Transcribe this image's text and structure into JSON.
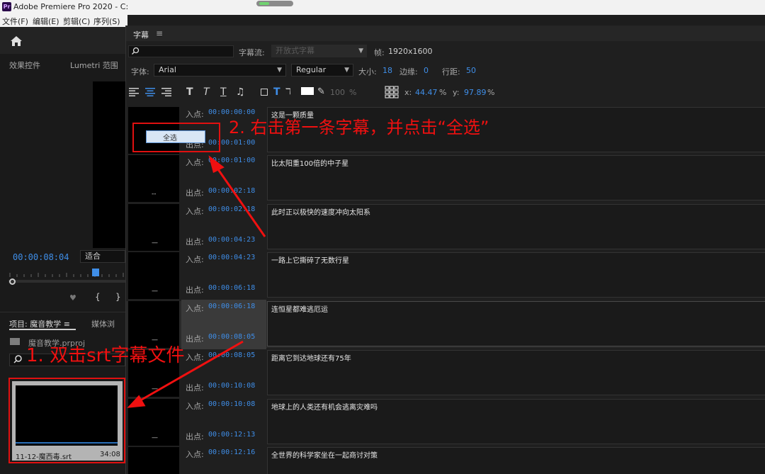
{
  "titlebar": {
    "app_icon": "Pr",
    "title": "Adobe Premiere Pro 2020 - C:"
  },
  "menubar": {
    "items": [
      "文件(F)",
      "编辑(E)",
      "剪辑(C)",
      "序列(S)"
    ]
  },
  "left_panel": {
    "tabs": {
      "effect_controls": "效果控件",
      "lumetri": "Lumetri 范围"
    },
    "timecode": "00:00:08:04",
    "fit": "适合",
    "project": {
      "tab": "项目: 魔音教学 ≡",
      "media_tab": "媒体浏",
      "file": "魔音教学.prproj",
      "thumbnail_name": "11-12-魔西毒.srt",
      "thumbnail_duration": "34:08"
    }
  },
  "caption_panel": {
    "title": "字幕",
    "stream_label": "字幕流:",
    "stream_value": "开放式字幕",
    "frame_label": "帧:",
    "frame_value": "1920x1600",
    "font_label": "字体:",
    "font_value": "Arial",
    "style_value": "Regular",
    "size_label": "大小:",
    "size_value": "18",
    "margin_label": "边缘:",
    "margin_value": "0",
    "lead_label": "行距:",
    "lead_value": "50",
    "opacity_value": "100",
    "opacity_pct": "%",
    "x_label": "x:",
    "x_value": "44.47",
    "y_label": "y:",
    "y_value": "97.89",
    "pct": "%",
    "in_label": "入点:",
    "out_label": "出点:",
    "rows": [
      {
        "in": "00:00:00:00",
        "out": "00:00:01:00",
        "text": "这是一颗质量",
        "mark": ""
      },
      {
        "in": "00:00:01:00",
        "out": "00:00:02:18",
        "text": "比太阳重100倍的中子星",
        "mark": "--"
      },
      {
        "in": "00:00:02:18",
        "out": "00:00:04:23",
        "text": "此时正以极快的速度冲向太阳系",
        "mark": "—"
      },
      {
        "in": "00:00:04:23",
        "out": "00:00:06:18",
        "text": "一路上它撕碎了无数行星",
        "mark": "—"
      },
      {
        "in": "00:00:06:18",
        "out": "00:00:08:05",
        "text": "连恒星都难逃厄运",
        "mark": "—"
      },
      {
        "in": "00:00:08:05",
        "out": "00:00:10:08",
        "text": "距离它到达地球还有75年",
        "mark": "—"
      },
      {
        "in": "00:00:10:08",
        "out": "00:00:12:13",
        "text": "地球上的人类还有机会逃离灾难吗",
        "mark": "—"
      },
      {
        "in": "00:00:12:16",
        "out": "",
        "text": "全世界的科学家坐在一起商讨对策",
        "mark": ""
      }
    ]
  },
  "context_menu": {
    "item": "全选"
  },
  "annotations": {
    "step1": "1. 双击srt字幕文件",
    "step2": "2. 右击第一条字幕，并点击“全选”"
  },
  "colors": {
    "accent": "#3f8ee8",
    "annotation": "#f01010"
  }
}
